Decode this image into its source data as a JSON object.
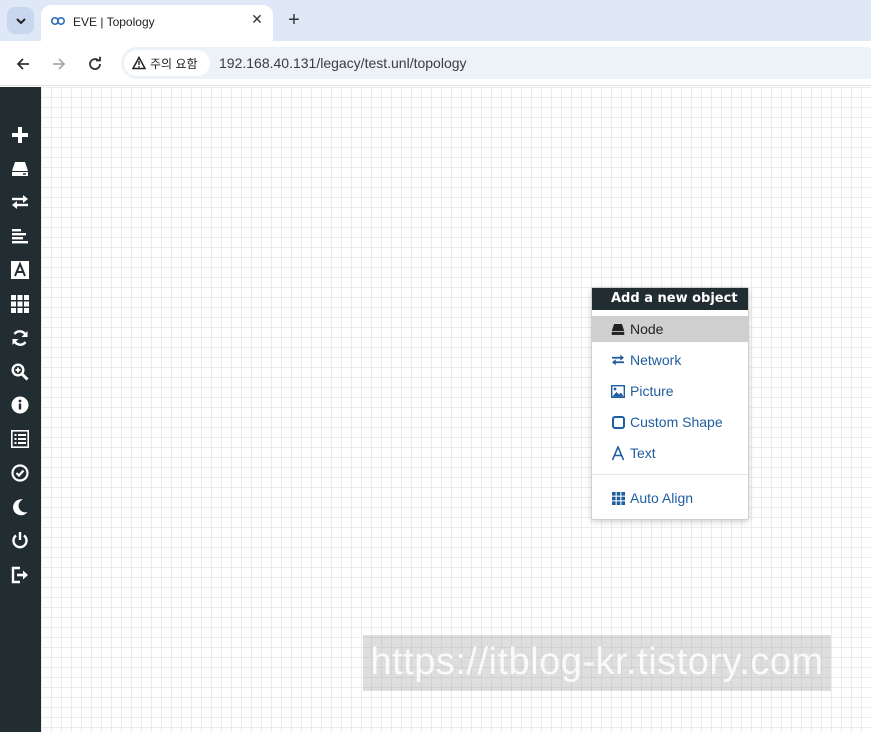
{
  "browser": {
    "tab_title": "EVE | Topology",
    "new_tab_symbol": "+",
    "close_symbol": "✕",
    "security_label": "주의 요함",
    "url": "192.168.40.131/legacy/test.unl/topology"
  },
  "sidebar": {
    "items": [
      {
        "icon": "plus-icon"
      },
      {
        "icon": "node-icon"
      },
      {
        "icon": "network-exchange-icon"
      },
      {
        "icon": "align-left-icon"
      },
      {
        "icon": "text-box-icon"
      },
      {
        "icon": "grid-icon"
      },
      {
        "icon": "refresh-icon"
      },
      {
        "icon": "zoom-in-icon"
      },
      {
        "icon": "info-icon"
      },
      {
        "icon": "list-icon"
      },
      {
        "icon": "check-circle-icon"
      },
      {
        "icon": "moon-icon"
      },
      {
        "icon": "power-icon"
      },
      {
        "icon": "logout-icon"
      }
    ]
  },
  "context_menu": {
    "title": "Add a new object",
    "items": [
      {
        "label": "Node",
        "icon": "node-icon",
        "active": true
      },
      {
        "label": "Network",
        "icon": "network-exchange-icon"
      },
      {
        "label": "Picture",
        "icon": "picture-icon"
      },
      {
        "label": "Custom Shape",
        "icon": "square-icon"
      },
      {
        "label": "Text",
        "icon": "text-icon"
      }
    ],
    "auto_align_label": "Auto Align"
  },
  "watermark": "https://itblog-kr.tistory.com",
  "colors": {
    "sidebar_bg": "#222d32",
    "menu_link": "#1f5e9e",
    "menu_active_bg": "#cfcfcf"
  }
}
